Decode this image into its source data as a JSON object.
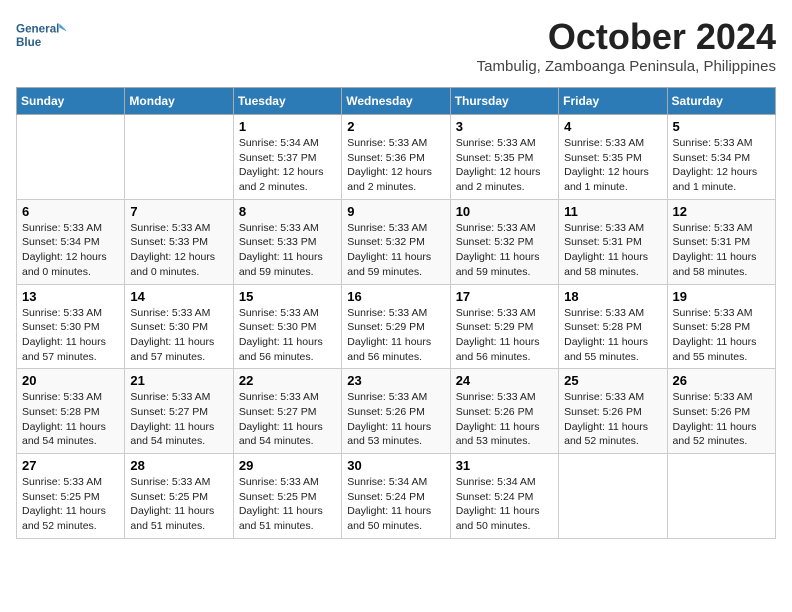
{
  "logo": {
    "line1": "General",
    "line2": "Blue"
  },
  "title": "October 2024",
  "location": "Tambulig, Zamboanga Peninsula, Philippines",
  "days_header": [
    "Sunday",
    "Monday",
    "Tuesday",
    "Wednesday",
    "Thursday",
    "Friday",
    "Saturday"
  ],
  "weeks": [
    [
      {
        "day": "",
        "sunrise": "",
        "sunset": "",
        "daylight": ""
      },
      {
        "day": "",
        "sunrise": "",
        "sunset": "",
        "daylight": ""
      },
      {
        "day": "1",
        "sunrise": "Sunrise: 5:34 AM",
        "sunset": "Sunset: 5:37 PM",
        "daylight": "Daylight: 12 hours and 2 minutes."
      },
      {
        "day": "2",
        "sunrise": "Sunrise: 5:33 AM",
        "sunset": "Sunset: 5:36 PM",
        "daylight": "Daylight: 12 hours and 2 minutes."
      },
      {
        "day": "3",
        "sunrise": "Sunrise: 5:33 AM",
        "sunset": "Sunset: 5:35 PM",
        "daylight": "Daylight: 12 hours and 2 minutes."
      },
      {
        "day": "4",
        "sunrise": "Sunrise: 5:33 AM",
        "sunset": "Sunset: 5:35 PM",
        "daylight": "Daylight: 12 hours and 1 minute."
      },
      {
        "day": "5",
        "sunrise": "Sunrise: 5:33 AM",
        "sunset": "Sunset: 5:34 PM",
        "daylight": "Daylight: 12 hours and 1 minute."
      }
    ],
    [
      {
        "day": "6",
        "sunrise": "Sunrise: 5:33 AM",
        "sunset": "Sunset: 5:34 PM",
        "daylight": "Daylight: 12 hours and 0 minutes."
      },
      {
        "day": "7",
        "sunrise": "Sunrise: 5:33 AM",
        "sunset": "Sunset: 5:33 PM",
        "daylight": "Daylight: 12 hours and 0 minutes."
      },
      {
        "day": "8",
        "sunrise": "Sunrise: 5:33 AM",
        "sunset": "Sunset: 5:33 PM",
        "daylight": "Daylight: 11 hours and 59 minutes."
      },
      {
        "day": "9",
        "sunrise": "Sunrise: 5:33 AM",
        "sunset": "Sunset: 5:32 PM",
        "daylight": "Daylight: 11 hours and 59 minutes."
      },
      {
        "day": "10",
        "sunrise": "Sunrise: 5:33 AM",
        "sunset": "Sunset: 5:32 PM",
        "daylight": "Daylight: 11 hours and 59 minutes."
      },
      {
        "day": "11",
        "sunrise": "Sunrise: 5:33 AM",
        "sunset": "Sunset: 5:31 PM",
        "daylight": "Daylight: 11 hours and 58 minutes."
      },
      {
        "day": "12",
        "sunrise": "Sunrise: 5:33 AM",
        "sunset": "Sunset: 5:31 PM",
        "daylight": "Daylight: 11 hours and 58 minutes."
      }
    ],
    [
      {
        "day": "13",
        "sunrise": "Sunrise: 5:33 AM",
        "sunset": "Sunset: 5:30 PM",
        "daylight": "Daylight: 11 hours and 57 minutes."
      },
      {
        "day": "14",
        "sunrise": "Sunrise: 5:33 AM",
        "sunset": "Sunset: 5:30 PM",
        "daylight": "Daylight: 11 hours and 57 minutes."
      },
      {
        "day": "15",
        "sunrise": "Sunrise: 5:33 AM",
        "sunset": "Sunset: 5:30 PM",
        "daylight": "Daylight: 11 hours and 56 minutes."
      },
      {
        "day": "16",
        "sunrise": "Sunrise: 5:33 AM",
        "sunset": "Sunset: 5:29 PM",
        "daylight": "Daylight: 11 hours and 56 minutes."
      },
      {
        "day": "17",
        "sunrise": "Sunrise: 5:33 AM",
        "sunset": "Sunset: 5:29 PM",
        "daylight": "Daylight: 11 hours and 56 minutes."
      },
      {
        "day": "18",
        "sunrise": "Sunrise: 5:33 AM",
        "sunset": "Sunset: 5:28 PM",
        "daylight": "Daylight: 11 hours and 55 minutes."
      },
      {
        "day": "19",
        "sunrise": "Sunrise: 5:33 AM",
        "sunset": "Sunset: 5:28 PM",
        "daylight": "Daylight: 11 hours and 55 minutes."
      }
    ],
    [
      {
        "day": "20",
        "sunrise": "Sunrise: 5:33 AM",
        "sunset": "Sunset: 5:28 PM",
        "daylight": "Daylight: 11 hours and 54 minutes."
      },
      {
        "day": "21",
        "sunrise": "Sunrise: 5:33 AM",
        "sunset": "Sunset: 5:27 PM",
        "daylight": "Daylight: 11 hours and 54 minutes."
      },
      {
        "day": "22",
        "sunrise": "Sunrise: 5:33 AM",
        "sunset": "Sunset: 5:27 PM",
        "daylight": "Daylight: 11 hours and 54 minutes."
      },
      {
        "day": "23",
        "sunrise": "Sunrise: 5:33 AM",
        "sunset": "Sunset: 5:26 PM",
        "daylight": "Daylight: 11 hours and 53 minutes."
      },
      {
        "day": "24",
        "sunrise": "Sunrise: 5:33 AM",
        "sunset": "Sunset: 5:26 PM",
        "daylight": "Daylight: 11 hours and 53 minutes."
      },
      {
        "day": "25",
        "sunrise": "Sunrise: 5:33 AM",
        "sunset": "Sunset: 5:26 PM",
        "daylight": "Daylight: 11 hours and 52 minutes."
      },
      {
        "day": "26",
        "sunrise": "Sunrise: 5:33 AM",
        "sunset": "Sunset: 5:26 PM",
        "daylight": "Daylight: 11 hours and 52 minutes."
      }
    ],
    [
      {
        "day": "27",
        "sunrise": "Sunrise: 5:33 AM",
        "sunset": "Sunset: 5:25 PM",
        "daylight": "Daylight: 11 hours and 52 minutes."
      },
      {
        "day": "28",
        "sunrise": "Sunrise: 5:33 AM",
        "sunset": "Sunset: 5:25 PM",
        "daylight": "Daylight: 11 hours and 51 minutes."
      },
      {
        "day": "29",
        "sunrise": "Sunrise: 5:33 AM",
        "sunset": "Sunset: 5:25 PM",
        "daylight": "Daylight: 11 hours and 51 minutes."
      },
      {
        "day": "30",
        "sunrise": "Sunrise: 5:34 AM",
        "sunset": "Sunset: 5:24 PM",
        "daylight": "Daylight: 11 hours and 50 minutes."
      },
      {
        "day": "31",
        "sunrise": "Sunrise: 5:34 AM",
        "sunset": "Sunset: 5:24 PM",
        "daylight": "Daylight: 11 hours and 50 minutes."
      },
      {
        "day": "",
        "sunrise": "",
        "sunset": "",
        "daylight": ""
      },
      {
        "day": "",
        "sunrise": "",
        "sunset": "",
        "daylight": ""
      }
    ]
  ]
}
